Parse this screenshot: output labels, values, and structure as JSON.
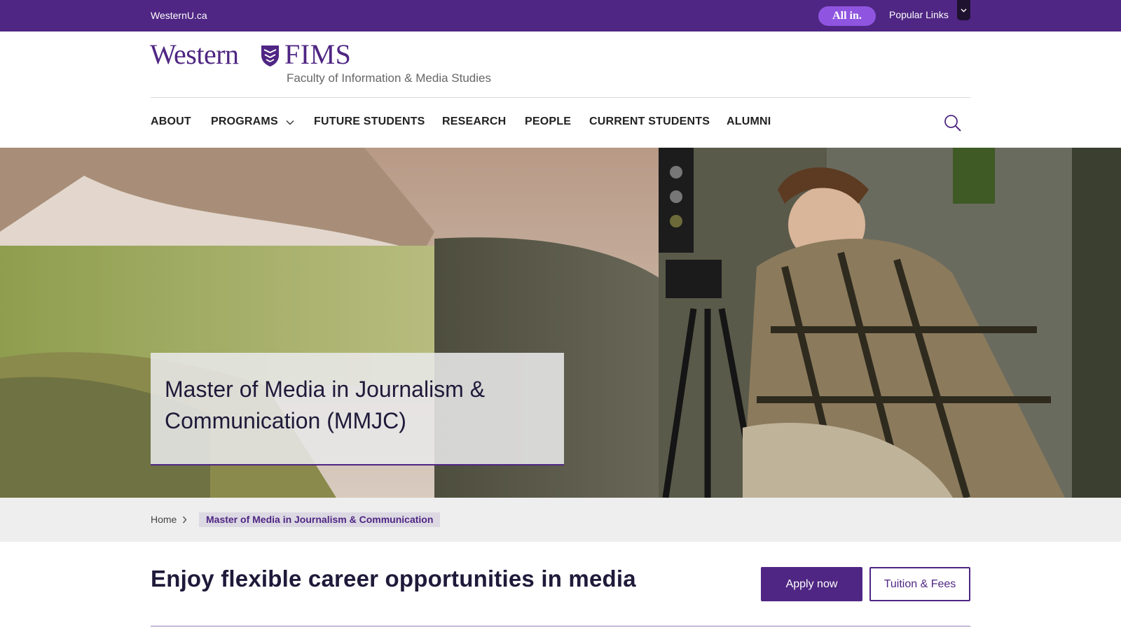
{
  "topbar": {
    "site_link": "WesternU.ca",
    "all_in": "All in.",
    "popular_links": "Popular Links"
  },
  "header": {
    "logo_western": "Western",
    "logo_fims": "FIMS",
    "faculty_name": "Faculty of Information & Media Studies",
    "search_icon": "search-icon"
  },
  "nav": {
    "items": [
      {
        "label": "ABOUT"
      },
      {
        "label": "PROGRAMS",
        "has_dropdown": true
      },
      {
        "label": "FUTURE STUDENTS"
      },
      {
        "label": "RESEARCH"
      },
      {
        "label": "PEOPLE"
      },
      {
        "label": "CURRENT STUDENTS"
      },
      {
        "label": "ALUMNI"
      }
    ]
  },
  "hero": {
    "title": "Master of Media in Journalism & Communication (MMJC)"
  },
  "breadcrumb": {
    "home": "Home",
    "current": "Master of Media in Journalism & Communication"
  },
  "content": {
    "heading": "Enjoy flexible career opportunities in media",
    "apply_label": "Apply now",
    "tuition_label": "Tuition & Fees"
  },
  "colors": {
    "brand_purple": "#4f2683",
    "accent_purple": "#8f55e0",
    "breadcrumb_bg": "#eeeeee"
  }
}
